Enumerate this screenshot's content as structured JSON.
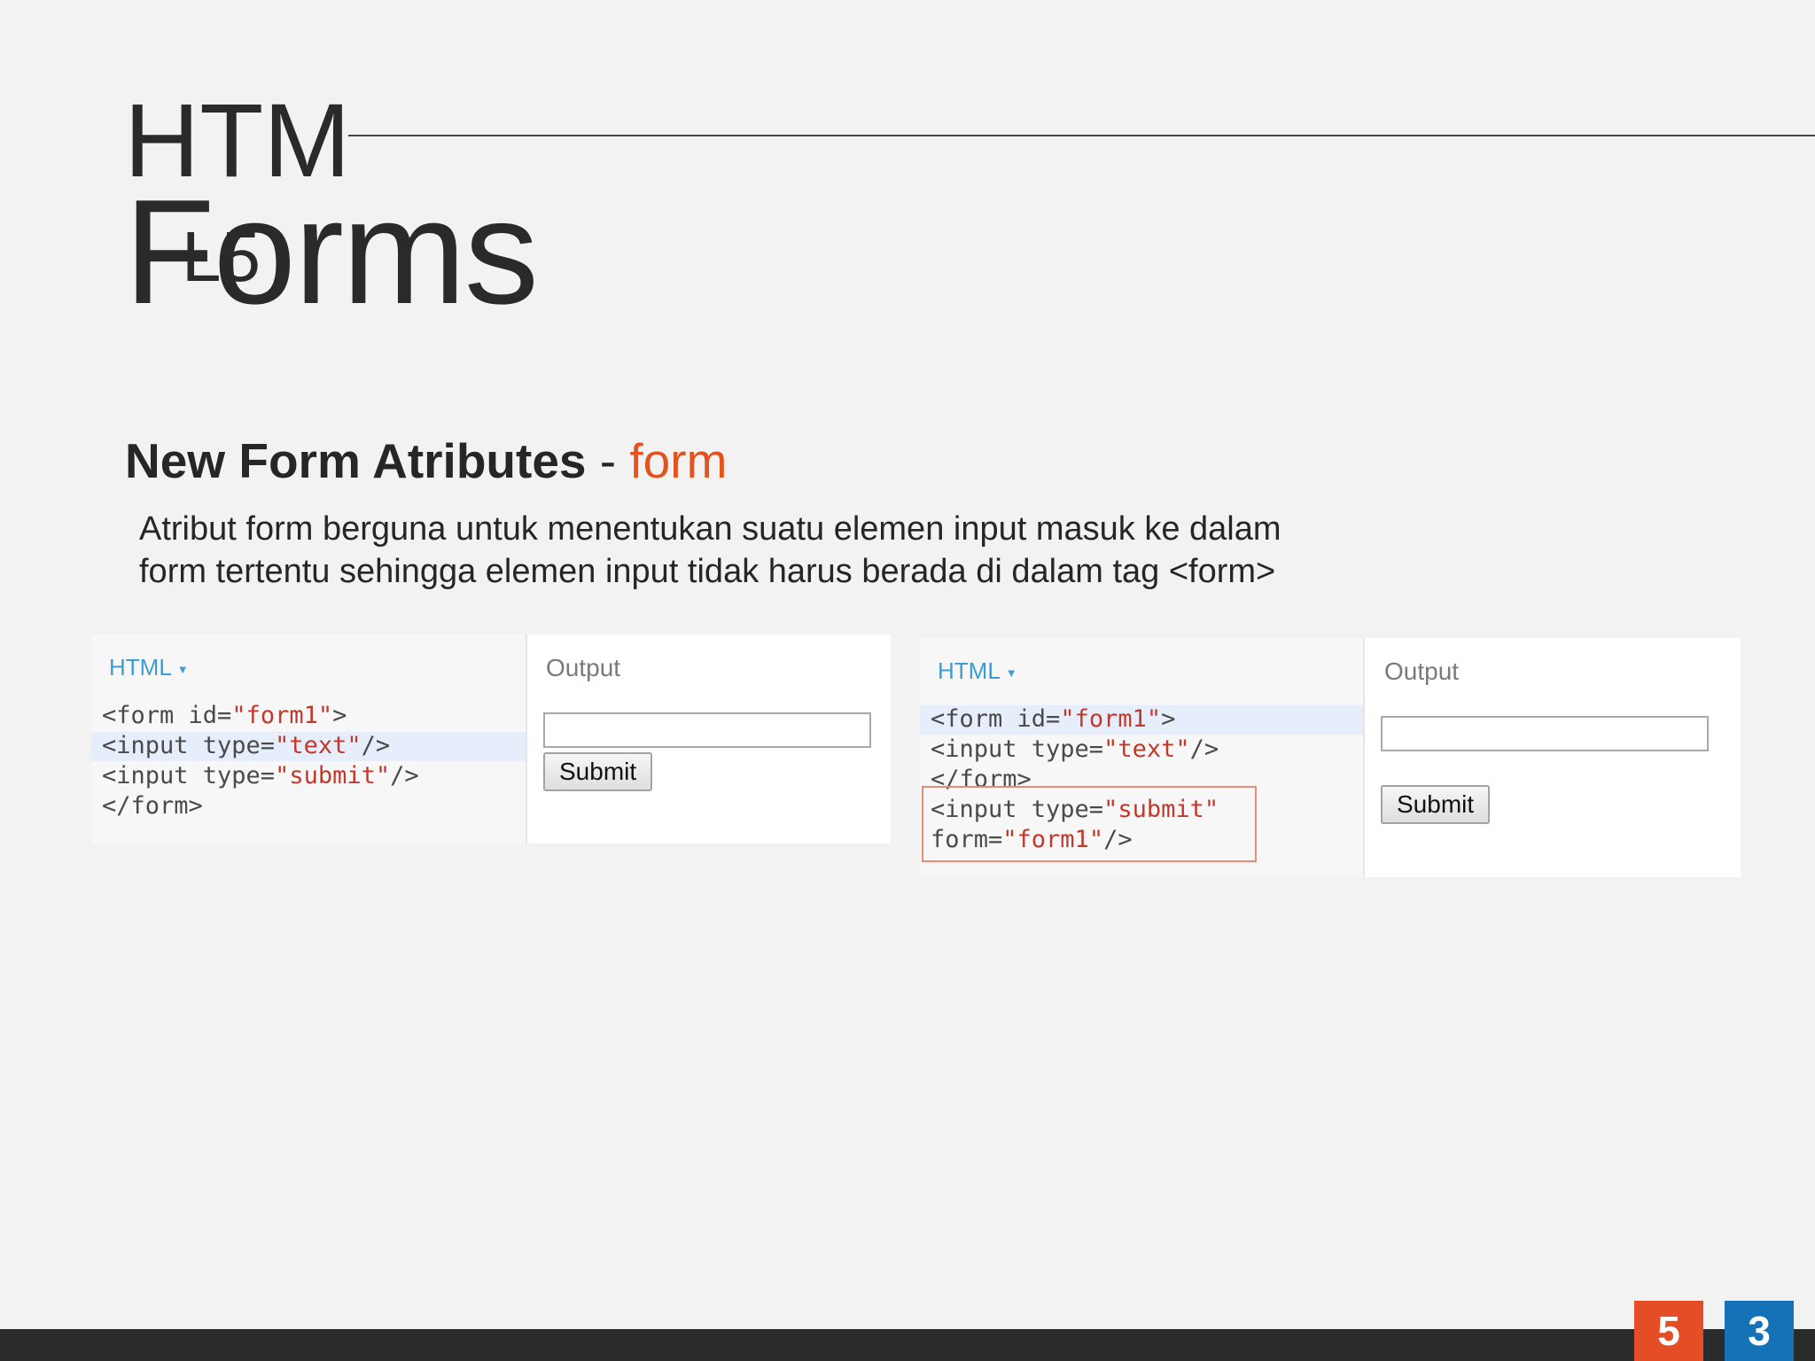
{
  "title": {
    "line1": "HTM",
    "line2": "Forms",
    "overlap": "L5"
  },
  "subtitle": {
    "main": "New Form Atributes",
    "dash": "-",
    "accent": "form"
  },
  "description": [
    "Atribut form berguna untuk menentukan suatu elemen input masuk ke dalam",
    "form tertentu sehingga elemen input tidak harus berada di dalam tag <form>"
  ],
  "examples": [
    {
      "code_label": "HTML",
      "code_lines": [
        [
          "<form id=",
          "\"form1\"",
          ">"
        ],
        [
          "<input type=",
          "\"text\"",
          "/>"
        ],
        [
          "<input type=",
          "\"submit\"",
          "/>"
        ],
        [
          "</form>",
          "",
          ""
        ]
      ],
      "output_label": "Output",
      "submit_label": "Submit"
    },
    {
      "code_label": "HTML",
      "code_lines": [
        [
          "<form id=",
          "\"form1\"",
          ">"
        ],
        [
          "<input type=",
          "\"text\"",
          "/>"
        ],
        [
          "</form>",
          "",
          ""
        ],
        [
          "<input type=",
          "\"submit\"",
          ""
        ],
        [
          "form=",
          "\"form1\"",
          "/>"
        ]
      ],
      "output_label": "Output",
      "submit_label": "Submit"
    }
  ],
  "logos": {
    "html5": "5",
    "css3": "3"
  },
  "colors": {
    "accent": "#e3531f",
    "html5": "#e44d26",
    "css3": "#1572b6",
    "code_label": "#3f9bd4"
  }
}
